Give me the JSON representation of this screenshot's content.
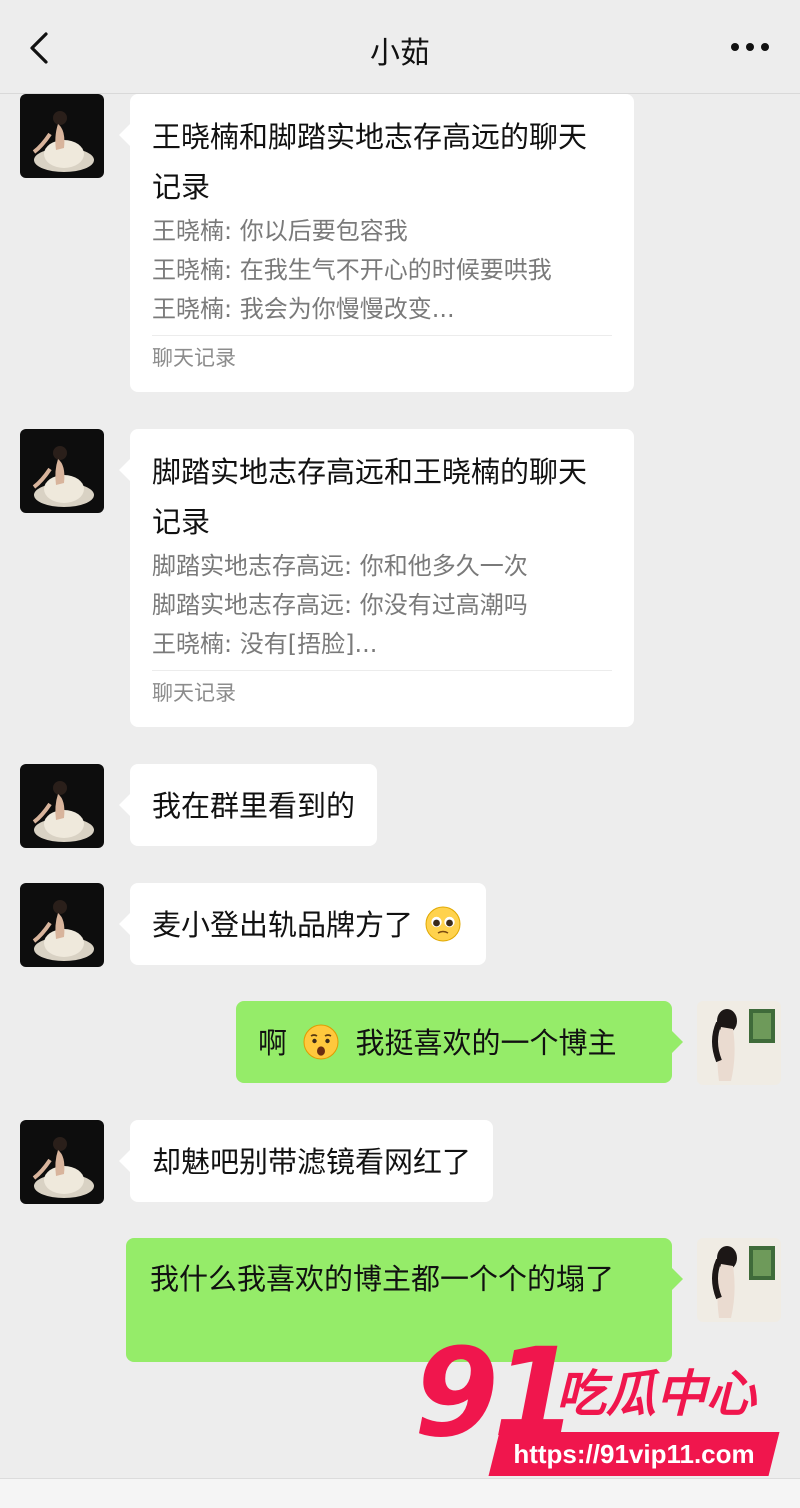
{
  "header": {
    "title": "小茹"
  },
  "messages": {
    "m1": {
      "title": "王晓楠和脚踏实地志存高远的聊天记录",
      "lines": [
        "王晓楠: 你以后要包容我",
        "王晓楠: 在我生气不开心的时候要哄我",
        "王晓楠: 我会为你慢慢改变..."
      ],
      "footer": "聊天记录"
    },
    "m2": {
      "title": "脚踏实地志存高远和王晓楠的聊天记录",
      "lines": [
        "脚踏实地志存高远: 你和他多久一次",
        "脚踏实地志存高远: 你没有过高潮吗",
        "王晓楠: 没有[捂脸]..."
      ],
      "footer": "聊天记录"
    },
    "m3": {
      "text": "我在群里看到的"
    },
    "m4": {
      "text": "麦小登出轨品牌方了",
      "emoji": "pleading-face-emoji"
    },
    "m5": {
      "text_before": "啊",
      "emoji": "anxious-face-emoji",
      "text_after": "我挺喜欢的一个博主"
    },
    "m6": {
      "text": "却魅吧别带滤镜看网红了"
    },
    "m7": {
      "text": "我什么我喜欢的博主都一个个的塌了"
    }
  },
  "watermark": {
    "number": "91",
    "name": "吃瓜中心",
    "url": "https://91vip11.com"
  },
  "icons": {
    "back": "chevron-left-icon",
    "more": "more-dots-icon"
  },
  "colors": {
    "sent_bubble": "#95ec69",
    "received_bubble": "#ffffff",
    "background": "#ededed",
    "watermark": "#f0164d"
  }
}
